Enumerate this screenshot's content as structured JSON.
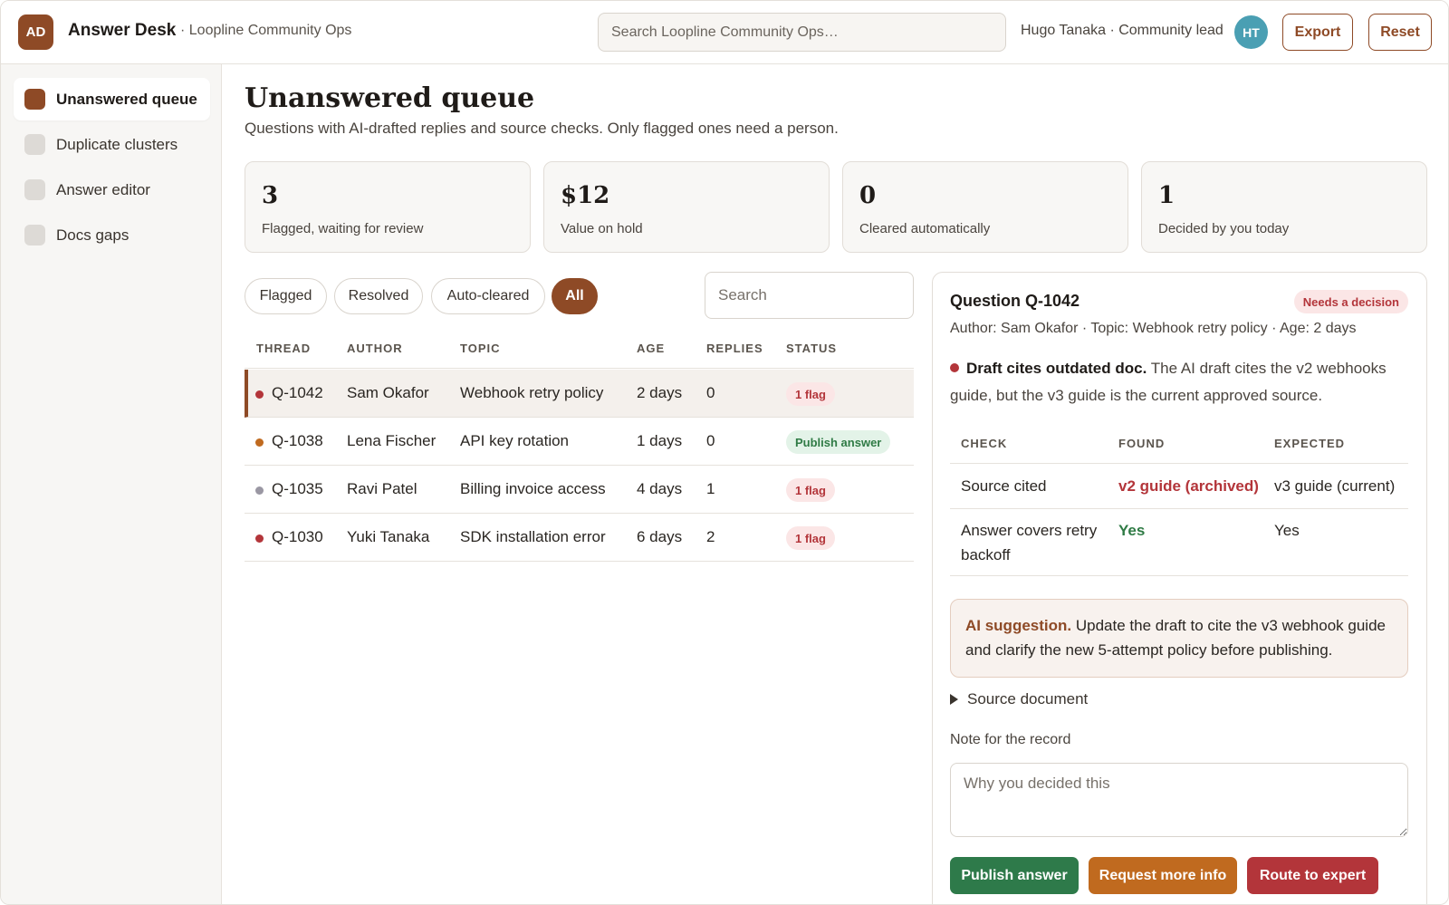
{
  "header": {
    "logo_text": "AD",
    "app_title": "Answer Desk",
    "workspace": "· Loopline Community Ops",
    "search_placeholder": "Search Loopline Community Ops…",
    "user_label": "Hugo Tanaka · Community lead",
    "avatar_initials": "HT",
    "export_label": "Export",
    "reset_label": "Reset"
  },
  "sidebar": {
    "items": [
      {
        "label": "Unanswered queue",
        "active": true
      },
      {
        "label": "Duplicate clusters",
        "active": false
      },
      {
        "label": "Answer editor",
        "active": false
      },
      {
        "label": "Docs gaps",
        "active": false
      }
    ]
  },
  "main": {
    "title": "Unanswered queue",
    "subtitle": "Questions with AI-drafted replies and source checks. Only flagged ones need a person.",
    "stats": [
      {
        "value": "3",
        "label": "Flagged, waiting for review"
      },
      {
        "value": "$12",
        "label": "Value on hold"
      },
      {
        "value": "0",
        "label": "Cleared automatically"
      },
      {
        "value": "1",
        "label": "Decided by you today"
      }
    ],
    "filters": [
      {
        "label": "Flagged",
        "active": false
      },
      {
        "label": "Resolved",
        "active": false
      },
      {
        "label": "Auto-cleared",
        "active": false
      },
      {
        "label": "All",
        "active": true
      }
    ],
    "table_search_placeholder": "Search",
    "columns": [
      "THREAD",
      "AUTHOR",
      "TOPIC",
      "AGE",
      "REPLIES",
      "STATUS"
    ],
    "rows": [
      {
        "thread": "Q-1042",
        "author": "Sam Okafor",
        "topic": "Webhook retry policy",
        "age": "2 days",
        "replies": "0",
        "status": "1 flag",
        "status_kind": "flag",
        "dot_color": "#b3353a",
        "selected": true
      },
      {
        "thread": "Q-1038",
        "author": "Lena Fischer",
        "topic": "API key rotation",
        "age": "1 days",
        "replies": "0",
        "status": "Publish answer",
        "status_kind": "ok",
        "dot_color": "#c06a1f",
        "selected": false
      },
      {
        "thread": "Q-1035",
        "author": "Ravi Patel",
        "topic": "Billing invoice access",
        "age": "4 days",
        "replies": "1",
        "status": "1 flag",
        "status_kind": "flag",
        "dot_color": "#9a97a3",
        "selected": false
      },
      {
        "thread": "Q-1030",
        "author": "Yuki Tanaka",
        "topic": "SDK installation error",
        "age": "6 days",
        "replies": "2",
        "status": "1 flag",
        "status_kind": "flag",
        "dot_color": "#b3353a",
        "selected": false
      }
    ]
  },
  "detail": {
    "title": "Question Q-1042",
    "badge": "Needs a decision",
    "meta": "Author: Sam Okafor · Topic: Webhook retry policy · Age: 2 days",
    "finding_title": "Draft cites outdated doc.",
    "finding_text": "The AI draft cites the v2 webhooks guide, but the v3 guide is the current approved source.",
    "check_columns": [
      "CHECK",
      "FOUND",
      "EXPECTED"
    ],
    "checks": [
      {
        "check": "Source cited",
        "found": "v2 guide (archived)",
        "expected": "v3 guide (current)",
        "found_state": "bad"
      },
      {
        "check": "Answer covers retry backoff",
        "found": "Yes",
        "expected": "Yes",
        "found_state": "good"
      }
    ],
    "suggestion_title": "AI suggestion.",
    "suggestion_text": "Update the draft to cite the v3 webhook guide and clarify the new 5-attempt policy before publishing.",
    "source_doc_label": "Source document",
    "note_label": "Note for the record",
    "note_placeholder": "Why you decided this",
    "actions": {
      "publish": "Publish answer",
      "request_info": "Request more info",
      "route": "Route to expert"
    }
  }
}
